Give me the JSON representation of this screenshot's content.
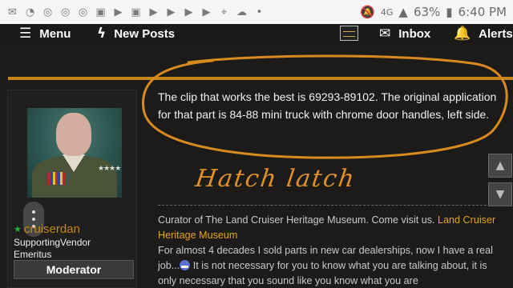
{
  "status_bar": {
    "left_icons": [
      "mail-icon",
      "gauge-icon",
      "planet-icon",
      "planet-icon",
      "planet-icon",
      "image-icon",
      "youtube-icon",
      "image-icon",
      "youtube-icon",
      "youtube-icon",
      "youtube-icon",
      "youtube-icon",
      "location-icon",
      "weather-icon",
      "dot-icon"
    ],
    "network": "4G",
    "battery": "63%",
    "time": "6:40 PM"
  },
  "nav": {
    "menu_label": "Menu",
    "new_posts_label": "New Posts",
    "inbox_label": "Inbox",
    "alerts_label": "Alerts"
  },
  "user": {
    "name": "cruiserdan",
    "title_line1": "SupportingVendor",
    "title_line2": "Emeritus",
    "role": "Moderator"
  },
  "post": {
    "body": "The clip that works the best is 69293-89102. The original application for that part is 84-88 mini truck with chrome door handles, left side.",
    "handwritten_annotation": "Hatch latch"
  },
  "signature": {
    "prefix": "Curator of The Land Cruiser Heritage Museum. Come visit us. ",
    "link_text": "Land Cruiser Heritage Museum",
    "text_a": "For almost 4 decades I sold parts in new car dealerships, now I have a real job...",
    "text_b": " It is not necessary for you to know what you are talking about, it is only necessary that you sound like you know what you are"
  },
  "colors": {
    "accent": "#c48614",
    "annotation": "#e0902a",
    "link": "#e8a41c",
    "background": "#1c1b1a"
  }
}
